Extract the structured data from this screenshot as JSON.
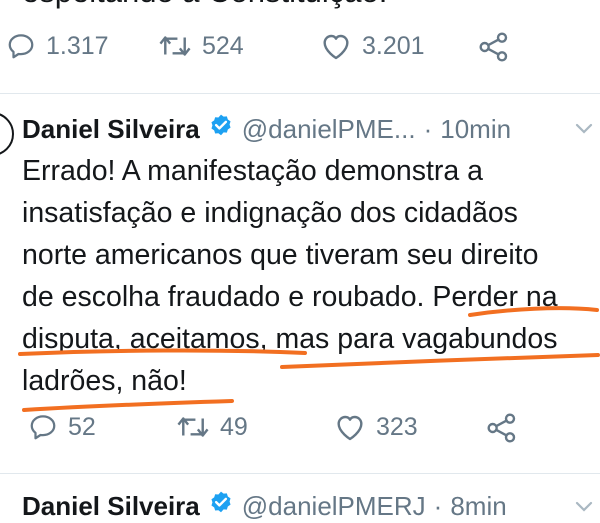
{
  "previous_tweet": {
    "text_fragment": "espeitando a Constituição.",
    "actions": {
      "replies": "1.317",
      "retweets": "524",
      "likes": "3.201"
    }
  },
  "tweet": {
    "author_name": "Daniel Silveira",
    "handle": "@danielPME...",
    "time": "10min",
    "handle_time_sep": "·",
    "lines": [
      "Errado! A manifestação demonstra a",
      "insatisfação e indignação dos cidadãos",
      "norte americanos  que tiveram seu direito",
      "de escolha fraudado e roubado. Perder na",
      "disputa, aceitamos, mas para vagabundos",
      "ladrões, não!"
    ],
    "actions": {
      "replies": "52",
      "retweets": "49",
      "likes": "323"
    }
  },
  "next_tweet": {
    "author_name": "Daniel Silveira",
    "handle": "@danielPMERJ",
    "time": "8min",
    "handle_time_sep": "·"
  },
  "colors": {
    "text": "#14171a",
    "muted": "#657786",
    "verified": "#1da1f2",
    "annotation": "#f26f21"
  },
  "icons": [
    "reply-icon",
    "retweet-icon",
    "like-icon",
    "share-icon",
    "verified-badge-icon",
    "chevron-down-icon"
  ]
}
